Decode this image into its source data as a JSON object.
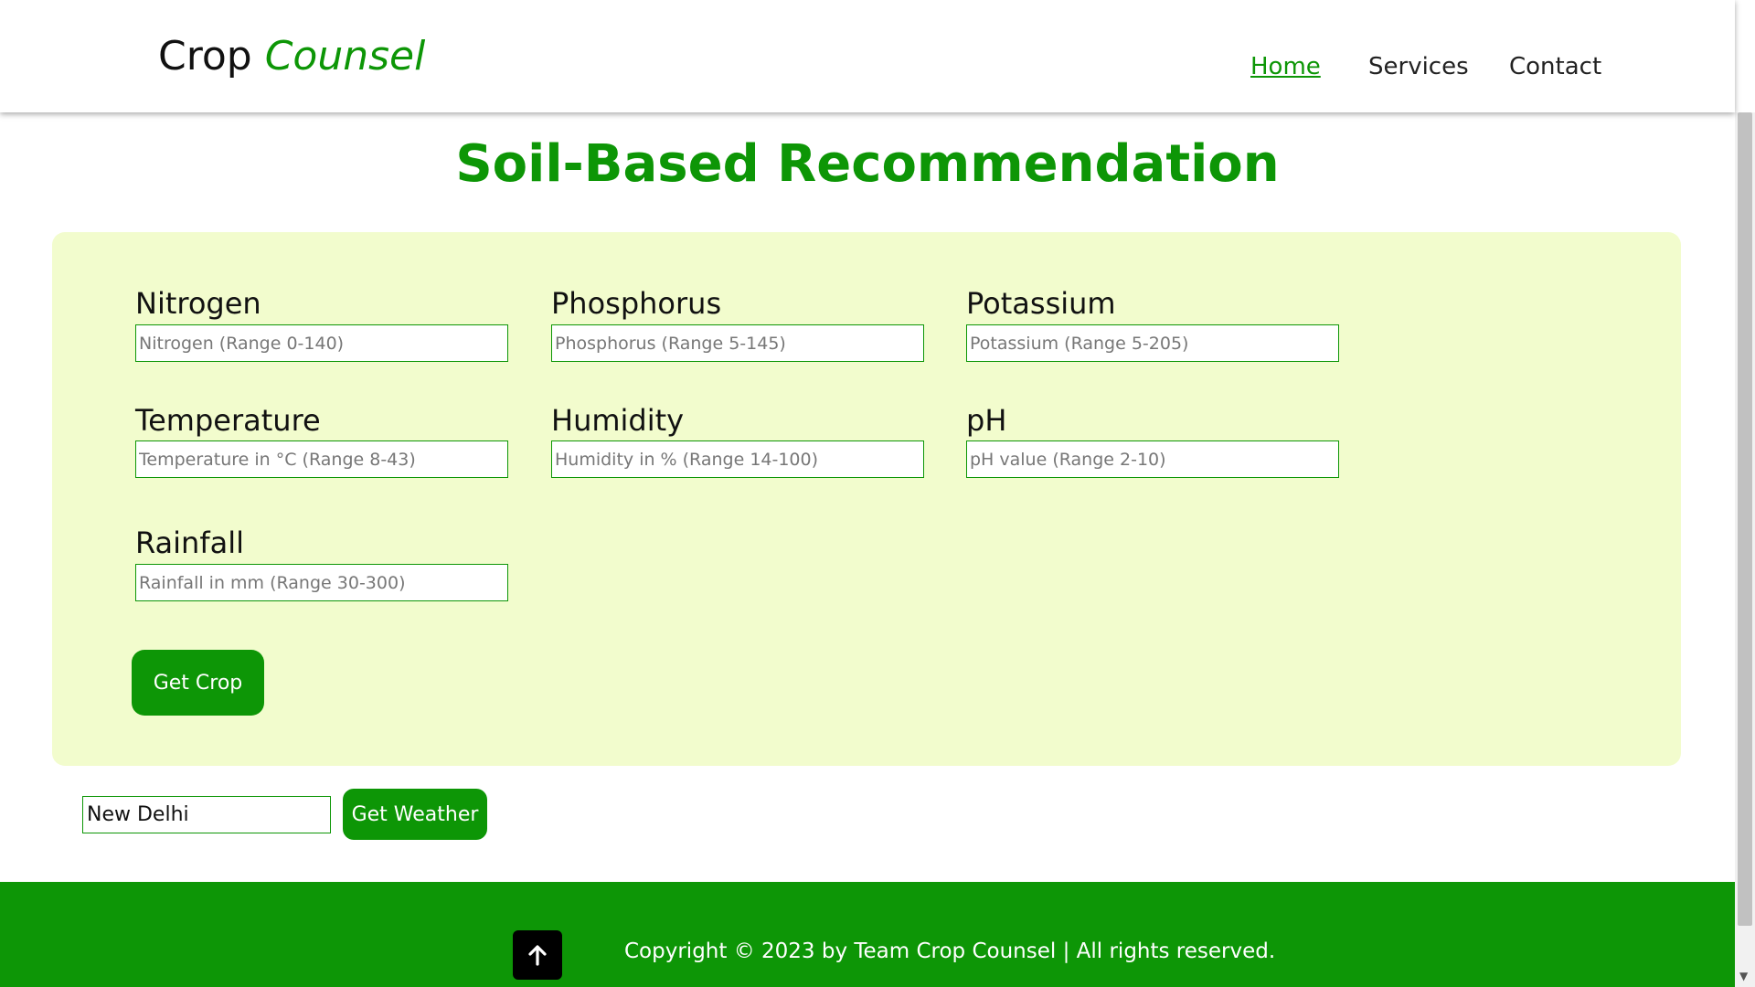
{
  "header": {
    "logo_word1": "Crop",
    "logo_word2": "Counsel",
    "nav": [
      {
        "label": "Home"
      },
      {
        "label": "Services"
      },
      {
        "label": "Contact"
      }
    ]
  },
  "main": {
    "title": "Soil-Based Recommendation",
    "fields": [
      {
        "label": "Nitrogen",
        "placeholder": "Nitrogen (Range 0-140)"
      },
      {
        "label": "Phosphorus",
        "placeholder": "Phosphorus (Range 5-145)"
      },
      {
        "label": "Potassium",
        "placeholder": "Potassium (Range 5-205)"
      },
      {
        "label": "Temperature",
        "placeholder": "Temperature in °C (Range 8-43)"
      },
      {
        "label": "Humidity",
        "placeholder": "Humidity in % (Range 14-100)"
      },
      {
        "label": "pH",
        "placeholder": "pH value (Range 2-10)"
      },
      {
        "label": "Rainfall",
        "placeholder": "Rainfall in mm (Range 30-300)"
      }
    ],
    "submit_label": "Get Crop"
  },
  "weather": {
    "city_value": "New Delhi",
    "button_label": "Get Weather"
  },
  "footer": {
    "copyright": "Copyright © 2023 by Team Crop Counsel | All rights reserved."
  },
  "colors": {
    "brand_green": "#0d9606",
    "panel_bg": "#f2fccd",
    "footer_bg": "#0d9606"
  },
  "icons": {
    "back_to_top": "arrow-up-icon"
  }
}
